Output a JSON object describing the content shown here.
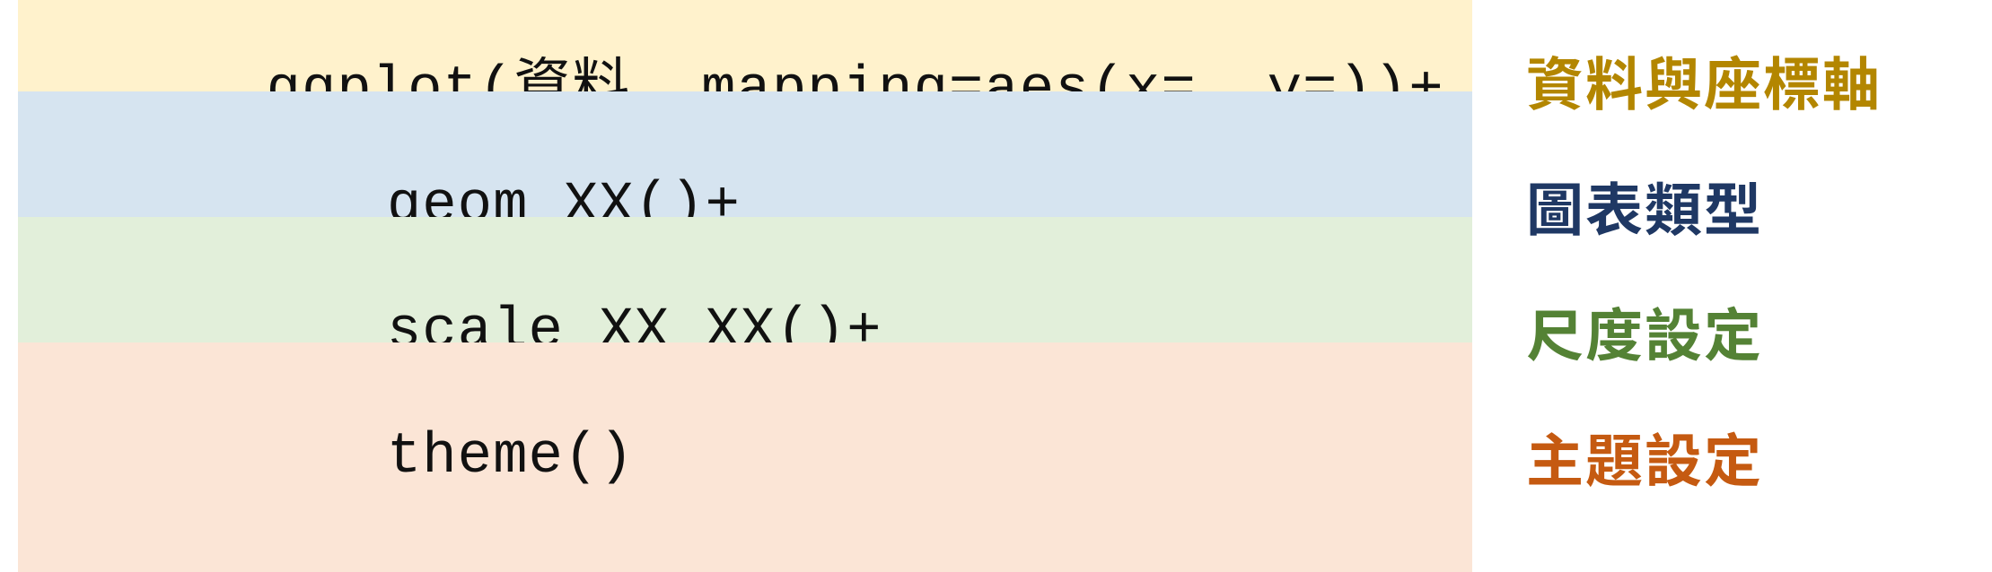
{
  "rows": [
    {
      "code": "ggplot(資料, mapping=aes(x=, y=))+",
      "indented": false,
      "label": "資料與座標軸",
      "bgClass": "bg-yellow",
      "labelColorClass": "clr-olive"
    },
    {
      "code": "geom_XX()+",
      "indented": true,
      "label": "圖表類型",
      "bgClass": "bg-blue",
      "labelColorClass": "clr-navy"
    },
    {
      "code": "scale_XX_XX()+",
      "indented": true,
      "label": "尺度設定",
      "bgClass": "bg-green",
      "labelColorClass": "clr-green"
    },
    {
      "code": "theme()",
      "indented": true,
      "label": "主題設定",
      "bgClass": "bg-orange",
      "labelColorClass": "clr-orange"
    }
  ]
}
